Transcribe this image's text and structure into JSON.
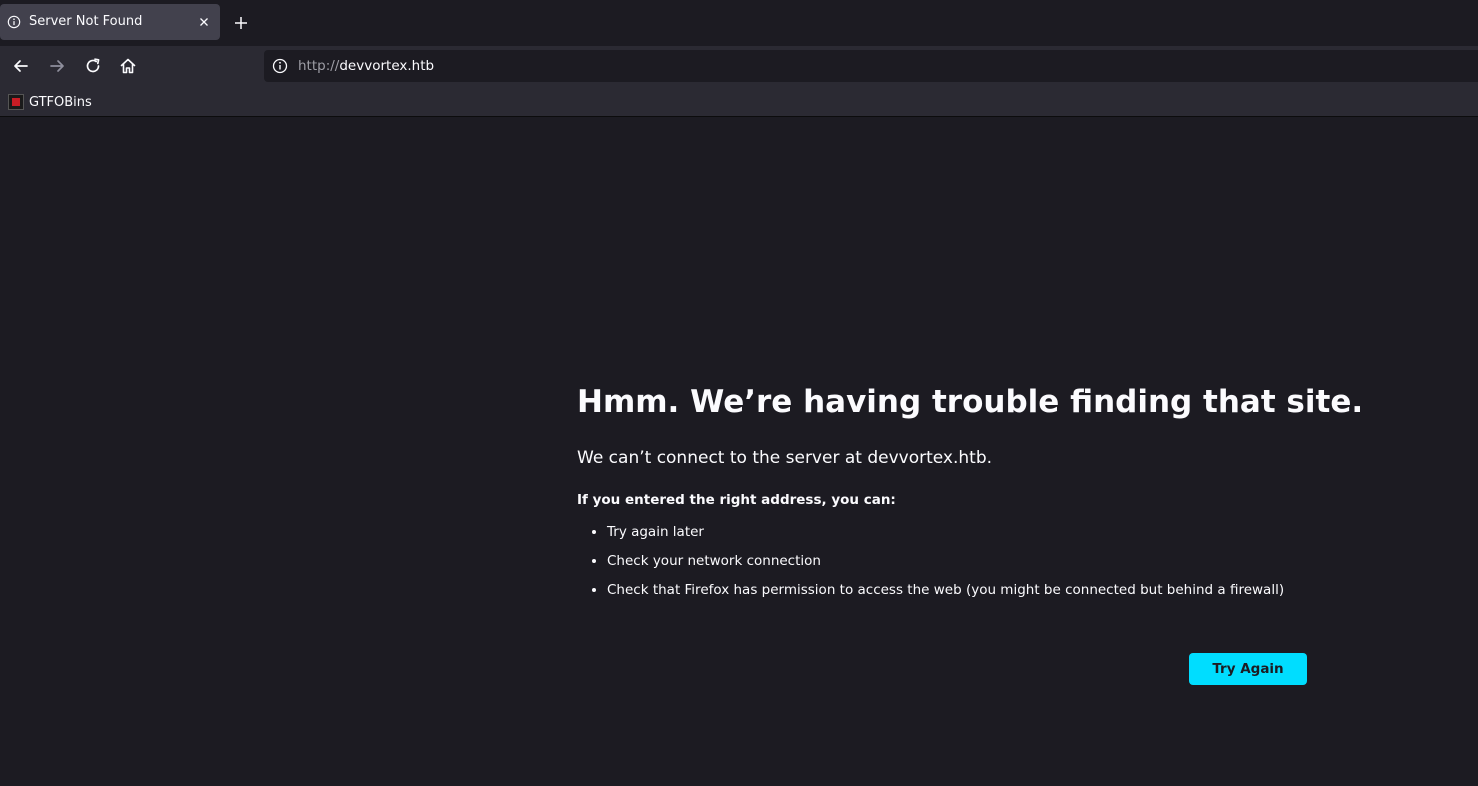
{
  "browser": {
    "tab": {
      "title": "Server Not Found",
      "icon": "info-icon"
    },
    "new_tab_icon": "plus-icon",
    "nav": {
      "back_icon": "arrow-left-icon",
      "forward_icon": "arrow-right-icon",
      "reload_icon": "reload-icon",
      "home_icon": "home-icon"
    },
    "urlbar": {
      "scheme": "http://",
      "host": "devvortex.htb",
      "icon": "info-icon"
    },
    "bookmarks": [
      {
        "label": "GTFOBins",
        "icon": "gtfobins-favicon"
      }
    ]
  },
  "error_page": {
    "title": "Hmm. We’re having trouble finding that site.",
    "short_desc": "We can’t connect to the server at devvortex.htb.",
    "advice_heading": "If you entered the right address, you can:",
    "advice_items": [
      "Try again later",
      "Check your network connection",
      "Check that Firefox has permission to access the web (you might be connected but behind a firewall)"
    ],
    "try_again_label": "Try Again"
  },
  "colors": {
    "page_bg": "#1c1b22",
    "toolbar_bg": "#2b2a33",
    "tab_active_bg": "#42414d",
    "accent_button": "#00ddff",
    "text": "#fbfbfe"
  }
}
